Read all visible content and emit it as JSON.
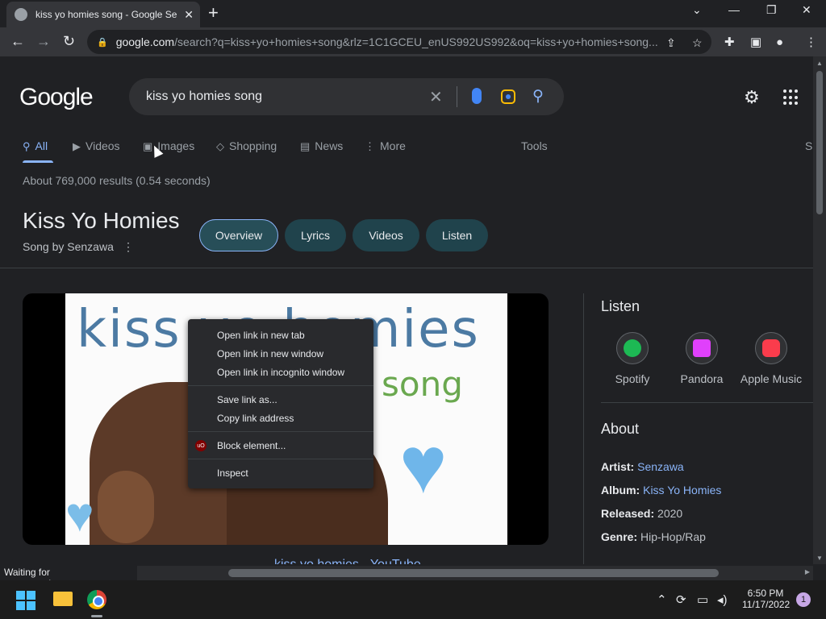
{
  "browser": {
    "tab_title": "kiss yo homies song - Google Se",
    "tab_close": "✕",
    "new_tab": "+",
    "url_host": "google.com",
    "url_rest": "/search?q=kiss+yo+homies+song&rlz=1C1GCEU_enUS992US992&oq=kiss+yo+homies+song..."
  },
  "google": {
    "logo": "Google",
    "query": "kiss yo homies song",
    "tabs": [
      {
        "label": "All",
        "icon": "search-icon"
      },
      {
        "label": "Videos",
        "icon": "video-icon"
      },
      {
        "label": "Images",
        "icon": "image-icon"
      },
      {
        "label": "Shopping",
        "icon": "tag-icon"
      },
      {
        "label": "News",
        "icon": "news-icon"
      },
      {
        "label": "More",
        "icon": "more-vert-icon"
      }
    ],
    "tools": "Tools",
    "s_cut": "S",
    "results_count": "About 769,000 results (0.54 seconds)"
  },
  "knowledge_panel": {
    "title": "Kiss Yo Homies",
    "subtitle": "Song by Senzawa",
    "chips": [
      "Overview",
      "Lyrics",
      "Videos",
      "Listen"
    ],
    "media_text_1": "kiss yo homies",
    "media_text_2": "song",
    "below_media": "kiss yo homies - YouTube",
    "listen_heading": "Listen",
    "services": [
      {
        "label": "Spotify",
        "color": "#1db954"
      },
      {
        "label": "Pandora",
        "color": "#e040fb"
      },
      {
        "label": "Apple Music",
        "color": "#fa3c4c"
      }
    ],
    "about_heading": "About",
    "facts": [
      {
        "label": "Artist:",
        "value": "Senzawa",
        "link": true
      },
      {
        "label": "Album:",
        "value": "Kiss Yo Homies",
        "link": true
      },
      {
        "label": "Released:",
        "value": "2020",
        "link": false
      },
      {
        "label": "Genre:",
        "value": "Hip-Hop/Rap",
        "link": false
      }
    ]
  },
  "context_menu": {
    "items": [
      "Open link in new tab",
      "Open link in new window",
      "Open link in incognito window",
      "Save link as...",
      "Copy link address",
      "Block element...",
      "Inspect"
    ],
    "ublock_badge": "uO"
  },
  "status_text": "Waiting for www.google.com...",
  "taskbar": {
    "time": "6:50 PM",
    "date": "11/17/2022",
    "notif_count": "1"
  }
}
